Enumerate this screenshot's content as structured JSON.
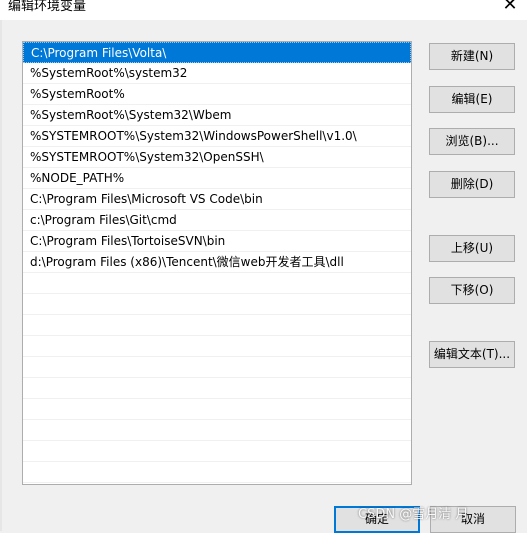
{
  "window": {
    "title": "编辑环境变量",
    "close_glyph": "✕"
  },
  "paths": [
    "C:\\Program Files\\Volta\\",
    "%SystemRoot%\\system32",
    "%SystemRoot%",
    "%SystemRoot%\\System32\\Wbem",
    "%SYSTEMROOT%\\System32\\WindowsPowerShell\\v1.0\\",
    "%SYSTEMROOT%\\System32\\OpenSSH\\",
    "%NODE_PATH%",
    "C:\\Program Files\\Microsoft VS Code\\bin",
    "c:\\Program Files\\Git\\cmd",
    "C:\\Program Files\\TortoiseSVN\\bin",
    "d:\\Program Files (x86)\\Tencent\\微信web开发者工具\\dll"
  ],
  "selected_index": 0,
  "buttons": {
    "new": "新建(N)",
    "edit": "编辑(E)",
    "browse": "浏览(B)...",
    "delete": "删除(D)",
    "move_up": "上移(U)",
    "move_down": "下移(O)",
    "edit_text": "编辑文本(T)...",
    "ok": "确定",
    "cancel": "取消"
  },
  "watermark": "CSDN @雪月清 月",
  "colors": {
    "selection": "#0078d7",
    "button_face": "#e1e1e1",
    "dialog_bg": "#f0f0f0"
  }
}
